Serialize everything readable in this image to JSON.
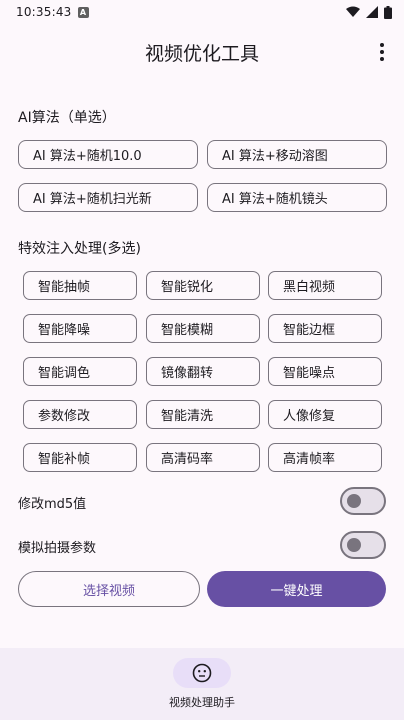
{
  "status_bar": {
    "time": "10:35:43",
    "notif_glyph": "A"
  },
  "app_bar": {
    "title": "视频优化工具"
  },
  "ai_section": {
    "title": "AI算法（单选）",
    "options": [
      "AI 算法+随机10.0",
      "AI 算法+移动溶图",
      "AI 算法+随机扫光新",
      "AI 算法+随机镜头"
    ]
  },
  "effects_section": {
    "title": "特效注入处理(多选)",
    "chips": [
      "智能抽帧",
      "智能锐化",
      "黑白视频",
      "智能降噪",
      "智能模糊",
      "智能边框",
      "智能调色",
      "镜像翻转",
      "智能噪点",
      "参数修改",
      "智能清洗",
      "人像修复",
      "智能补帧",
      "高清码率",
      "高清帧率"
    ]
  },
  "toggles": [
    {
      "label": "修改md5值",
      "on": false
    },
    {
      "label": "模拟拍摄参数",
      "on": false
    }
  ],
  "actions": {
    "select_video": "选择视频",
    "process": "一键处理"
  },
  "bottom_nav": {
    "label": "视频处理助手",
    "icon": "face-icon"
  },
  "colors": {
    "primary": "#6750a4",
    "background": "#fdf8fc",
    "outline": "#79747e",
    "nav_bg": "#f3edf7",
    "nav_pill": "#e8def8"
  }
}
